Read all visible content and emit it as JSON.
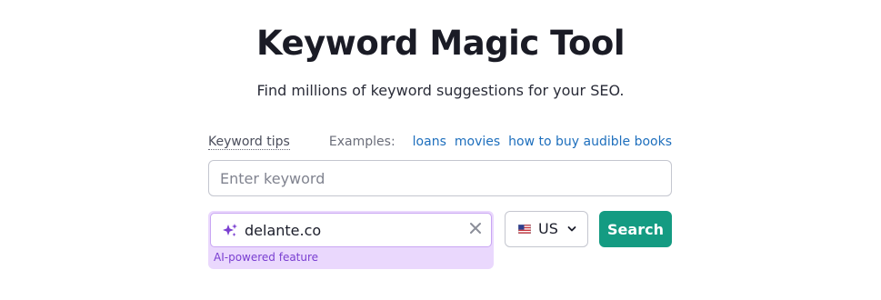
{
  "header": {
    "title": "Keyword Magic Tool",
    "subtitle": "Find millions of keyword suggestions for your SEO."
  },
  "tips": {
    "link_label": "Keyword tips",
    "examples_label": "Examples:",
    "examples": [
      "loans",
      "movies",
      "how to buy audible books"
    ]
  },
  "keyword_input": {
    "placeholder": "Enter keyword",
    "value": ""
  },
  "domain_input": {
    "value": "delante.co",
    "icon": "sparkle-icon",
    "ai_label": "AI-powered feature"
  },
  "country": {
    "selected": "US",
    "flag_icon": "us-flag-icon"
  },
  "search_button": {
    "label": "Search"
  },
  "colors": {
    "accent": "#149b82",
    "link": "#1e6fbd",
    "ai_purple": "#7a3fd1",
    "ai_bg": "#ead8fd"
  }
}
